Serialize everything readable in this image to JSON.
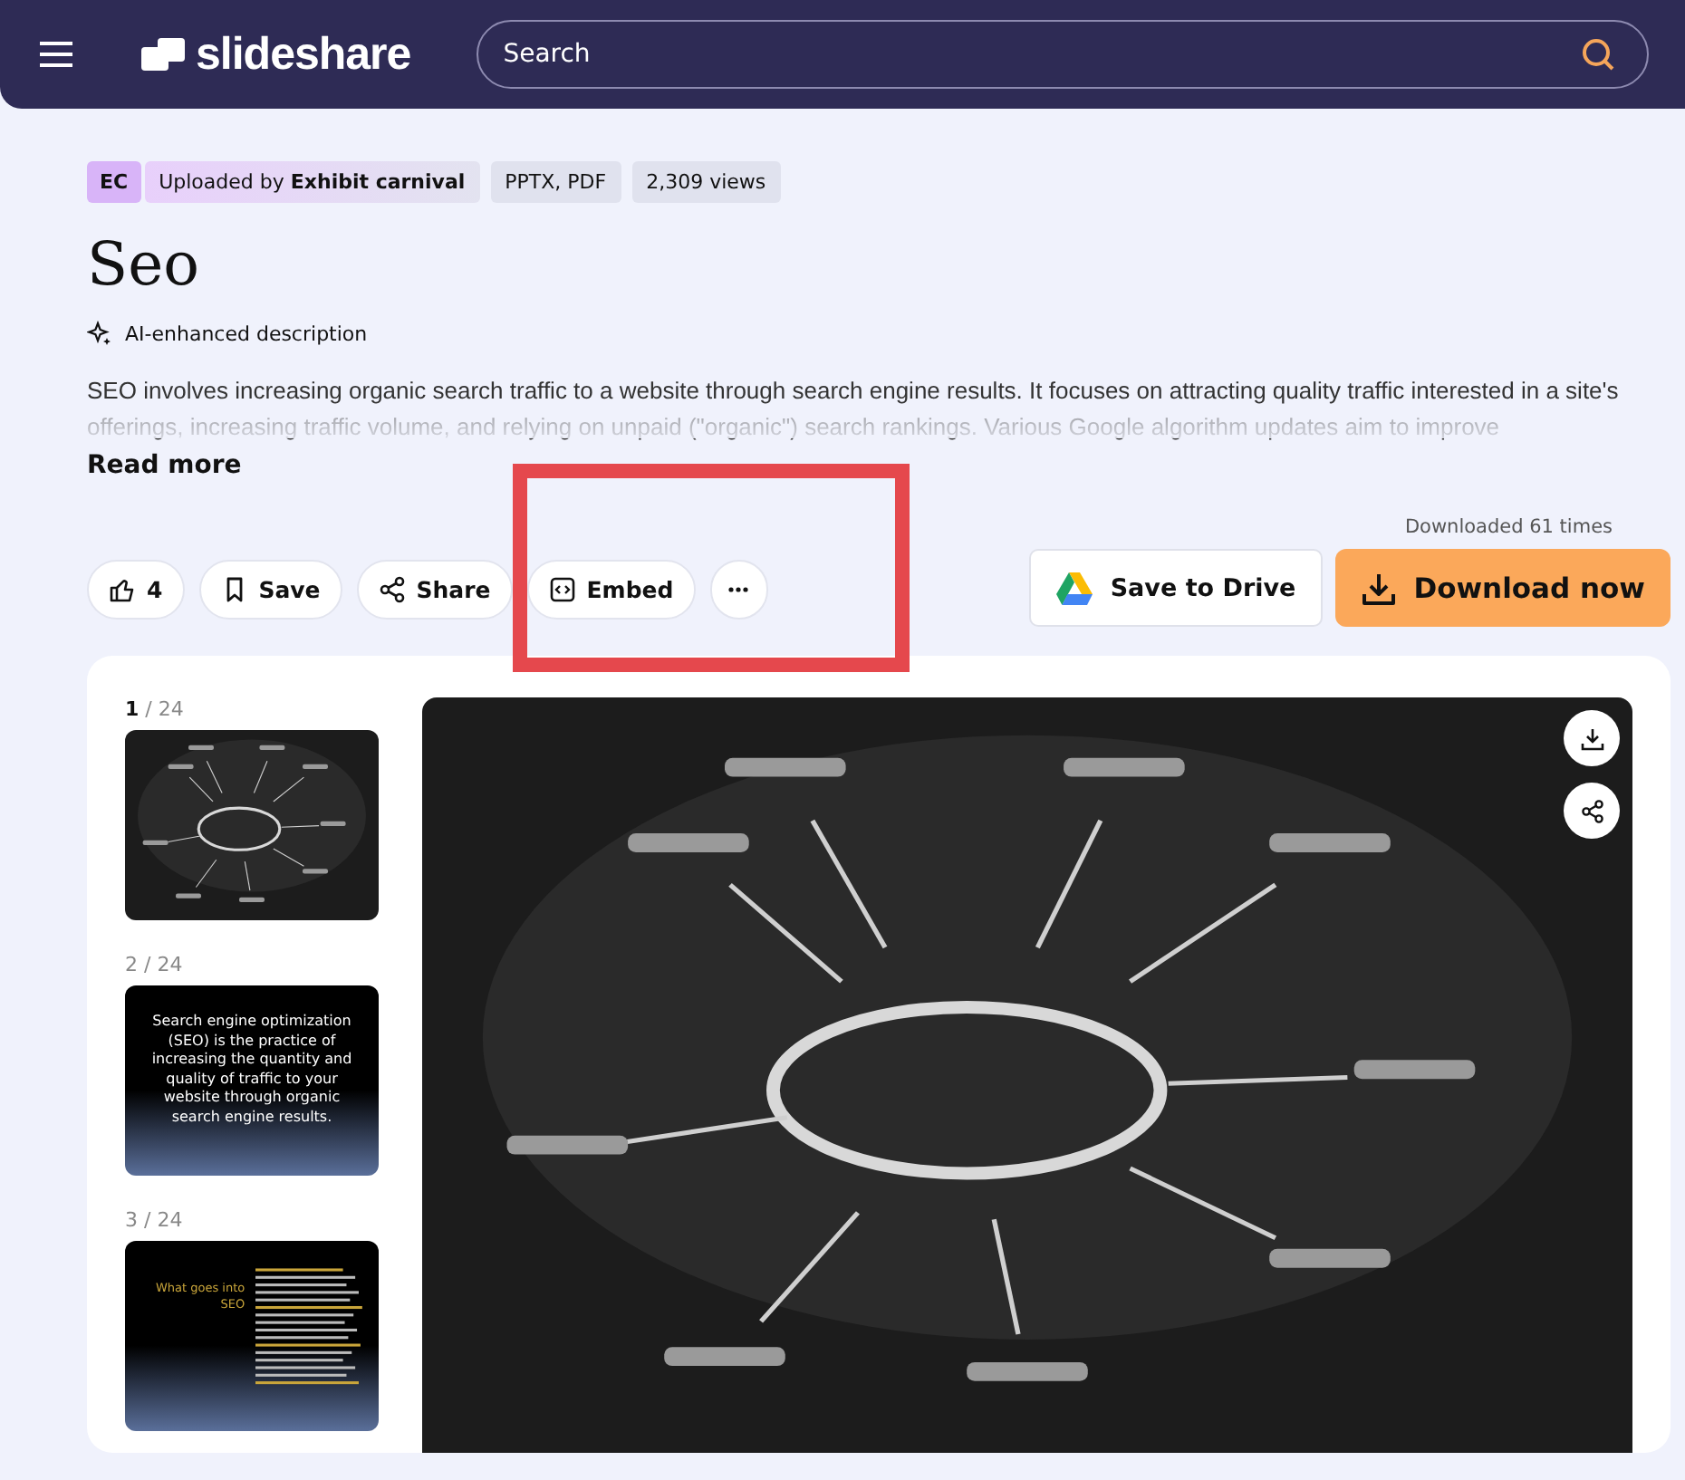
{
  "header": {
    "logo": "slideshare",
    "search": {
      "placeholder": "Search"
    }
  },
  "meta": {
    "avatar": "EC",
    "uploader": "Uploaded by **Exhibit carnival**",
    "tags": [
      "PPTX, PDF",
      "2,309 views"
    ]
  },
  "title": "Seo",
  "ai_label": "AI-enhanced description",
  "description": "SEO involves increasing organic search traffic to a website through search engine results. It focuses on attracting quality traffic interested in a site's offerings, increasing traffic volume, and relying on unpaid (\"organic\") search rankings. Various Google algorithm updates aim to improve",
  "read_more": "Read more",
  "actions": [
    {
      "kind": "like",
      "label": "4"
    },
    {
      "kind": "save",
      "label": "Save"
    },
    {
      "kind": "share",
      "label": "Share"
    },
    {
      "kind": "embed",
      "label": "Embed"
    },
    {
      "kind": "more"
    }
  ],
  "download_count": "Downloaded 61 times",
  "save_to_drive": "Save to Drive",
  "download": "Download now",
  "thumbnails": [
    {
      "page": "1",
      "of": "/ 24",
      "selected": true,
      "kind": "picture"
    },
    {
      "page": "2",
      "of": "/ 24",
      "selected": false,
      "kind": "text",
      "text": "Search engine optimization (SEO) is the practice of increasing the quantity and quality of traffic to your website through organic search engine results."
    },
    {
      "page": "3",
      "of": "/ 24",
      "selected": false,
      "kind": "title",
      "title": "What goes into SEO"
    }
  ],
  "annotations": [
    {
      "kind": "rectangle"
    }
  ]
}
